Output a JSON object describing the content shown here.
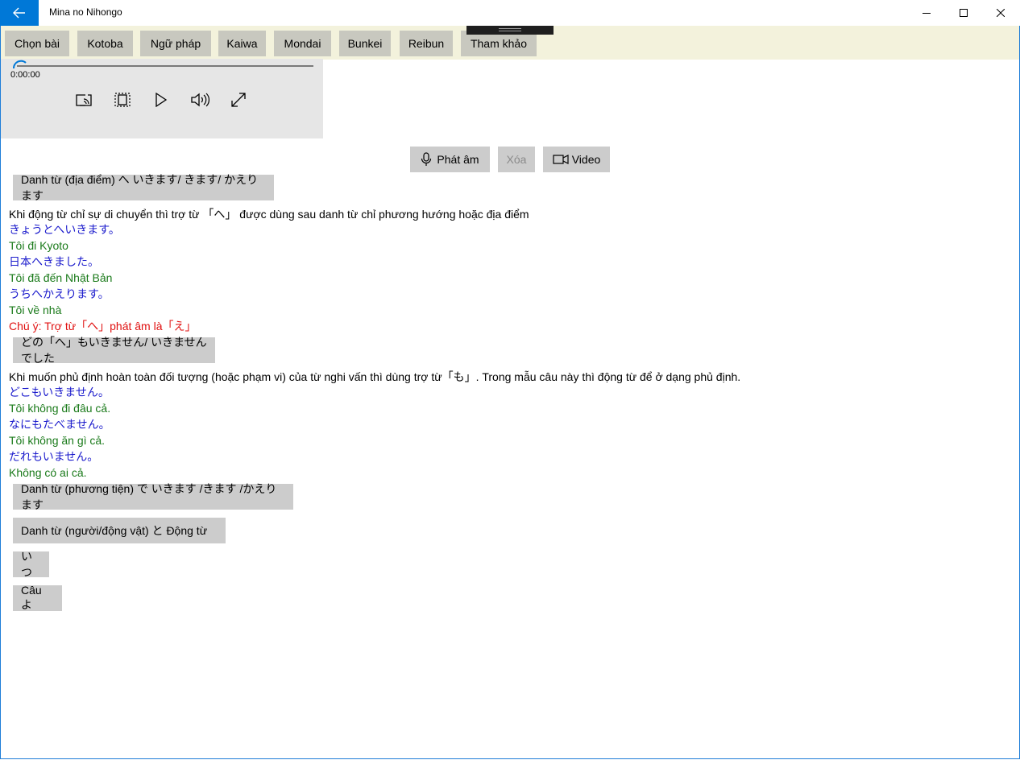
{
  "window": {
    "title": "Mina no Nihongo"
  },
  "nav": {
    "items": [
      "Chọn bài",
      "Kotoba",
      "Ngữ pháp",
      "Kaiwa",
      "Mondai",
      "Bunkei",
      "Reibun",
      "Tham khảo"
    ]
  },
  "player": {
    "time": "0:00:00",
    "progress": 0
  },
  "actions": {
    "pronounce": "Phát âm",
    "delete": "Xóa",
    "video": "Video"
  },
  "sections": [
    {
      "heading": "Danh từ (địa điểm) へ いきます/ きます/ かえります",
      "description": "Khi động từ chỉ sự di chuyển thì trợ từ 「へ」 được dùng sau danh từ chỉ phương hướng hoặc địa điểm",
      "lines": [
        {
          "type": "jp",
          "text": "きょうとへいきます。"
        },
        {
          "type": "vi",
          "text": "Tôi đi Kyoto"
        },
        {
          "type": "jp",
          "text": "日本へきました。"
        },
        {
          "type": "vi",
          "text": "Tôi đã đến Nhật Bản"
        },
        {
          "type": "jp",
          "text": "うちへかえります。"
        },
        {
          "type": "vi",
          "text": "Tôi về nhà"
        },
        {
          "type": "note",
          "text": "Chú ý: Trợ từ「へ」phát âm là「え」"
        }
      ]
    },
    {
      "heading": "どの「へ」もいきません/ いきませんでした",
      "description": "Khi muốn phủ định hoàn toàn đối tượng (hoặc phạm vi) của từ nghi vấn thì dùng trợ từ「も」. Trong mẫu câu này thì động từ để ở dạng phủ định.",
      "lines": [
        {
          "type": "jp",
          "text": "どこもいきません。"
        },
        {
          "type": "vi",
          "text": "Tôi không đi đâu cả."
        },
        {
          "type": "jp",
          "text": "なにもたべません。"
        },
        {
          "type": "vi",
          "text": "Tôi không ăn gì cả."
        },
        {
          "type": "jp",
          "text": "だれもいません。"
        },
        {
          "type": "vi",
          "text": "Không có ai cả."
        }
      ]
    },
    {
      "heading": "Danh từ (phương tiện) で いきます /きます /かえります"
    },
    {
      "heading": "Danh từ (người/động vật) と Động từ"
    },
    {
      "heading": "いつ"
    },
    {
      "heading": "Câu よ"
    }
  ],
  "colors": {
    "accent": "#0078d7",
    "navbar": "#f3f2dc",
    "japanese": "#1a1acc",
    "vietnamese": "#1a7a1a",
    "note": "#e01010"
  }
}
